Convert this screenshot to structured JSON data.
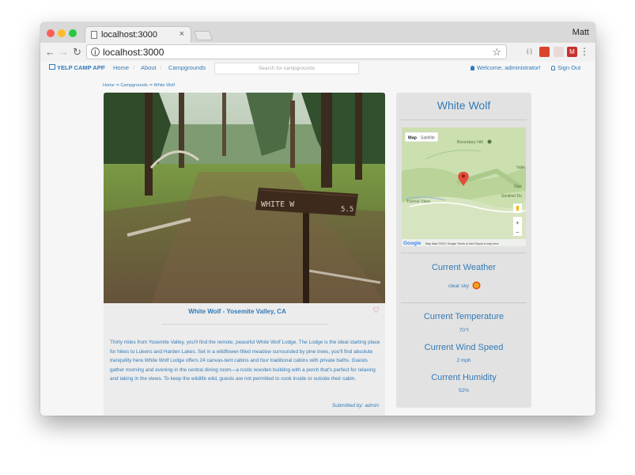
{
  "browser": {
    "tab_title": "localhost:3000",
    "tab_close": "×",
    "user_name": "Matt",
    "url": "localhost:3000",
    "nav": {
      "back": "←",
      "forward": "→",
      "reload": "↻"
    },
    "star": "☆",
    "info": "i",
    "menu": "⋮",
    "extensions": [
      {
        "name": "braces-extension",
        "text": "{·}",
        "color": "#f1f1f1"
      },
      {
        "name": "red-extension",
        "text": "",
        "color": "#d9452c"
      },
      {
        "name": "grey-extension",
        "text": "",
        "color": "#e7dada"
      },
      {
        "name": "gmail-extension",
        "text": "M",
        "color": "#c9302c"
      }
    ]
  },
  "nav": {
    "brand": "YELP CAMP APP",
    "links": [
      "Home",
      "About",
      "Campgrounds"
    ],
    "separator": "/",
    "search_placeholder": "Search for campgrounds",
    "welcome": "Welcome, administrator!",
    "sign_out": "Sign Out"
  },
  "breadcrumb": "Home ⇒ Campgrounds ⇒ White Wolf",
  "campground": {
    "sign_text": "WHITE W",
    "sign_number": "5.5",
    "caption": "White Wolf - Yosemite Valley, CA",
    "heart": "♡",
    "description": "Thirty miles from Yosemite Valley, you'll find the remote, peaceful White Wolf Lodge. The Lodge is the ideal starting place for hikes to Lukens and Harden Lakes. Set in a wildflower-filled meadow surrounded by pine trees, you'll find absolute tranquility here.White Wolf Lodge offers 24 canvas-tent cabins and four traditional cabins with private baths. Guests gather morning and evening in the central dining room—a rustic wooden building with a porch that's perfect for relaxing and taking in the views. To keep the wildlife wild, guests are not permitted to cook inside or outside their cabin.",
    "submitted": "Submitted by: admin"
  },
  "sidebar": {
    "title": "White Wolf",
    "map": {
      "tab_map": "Map",
      "tab_satellite": "Satellite",
      "label_boundary_hill": "Boundary Hill",
      "label_tunnel_view": "Tunnel View",
      "label_glacier": "Glac",
      "label_sentinel": "Sentinel Do",
      "label_valley": "Valle",
      "zoom_in": "+",
      "zoom_out": "−",
      "google": "Google",
      "footer": "Map data ©2017 Google   Terms of Use   Report a map error"
    },
    "weather_heading": "Current Weather",
    "weather_value": "clear sky",
    "temp_heading": "Current Temperature",
    "temp_value": "70°f",
    "wind_heading": "Current Wind Speed",
    "wind_value": "2 mph",
    "humidity_heading": "Current Humidity",
    "humidity_value": "52%"
  }
}
